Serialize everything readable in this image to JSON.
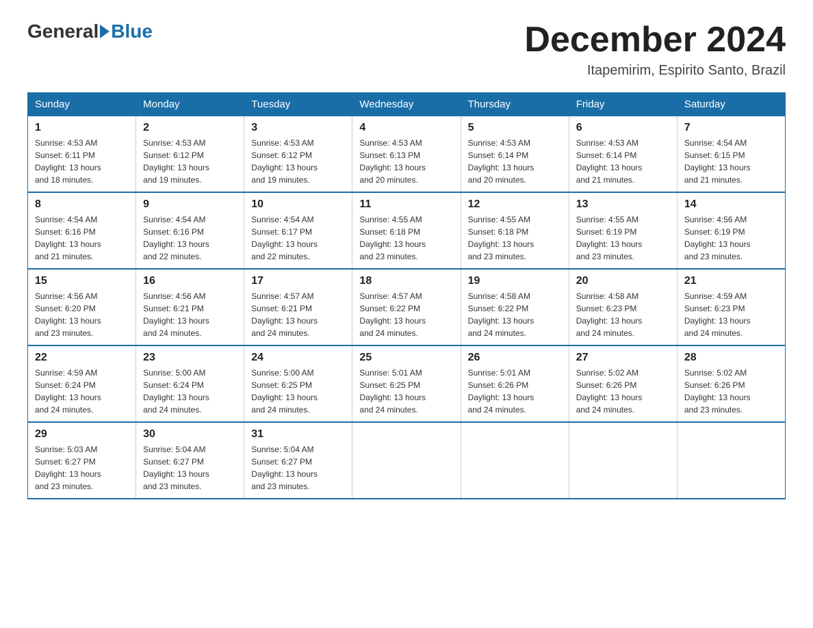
{
  "logo": {
    "general": "General",
    "blue": "Blue"
  },
  "title": "December 2024",
  "subtitle": "Itapemirim, Espirito Santo, Brazil",
  "days_of_week": [
    "Sunday",
    "Monday",
    "Tuesday",
    "Wednesday",
    "Thursday",
    "Friday",
    "Saturday"
  ],
  "weeks": [
    [
      {
        "day": "1",
        "sunrise": "4:53 AM",
        "sunset": "6:11 PM",
        "daylight": "13 hours and 18 minutes."
      },
      {
        "day": "2",
        "sunrise": "4:53 AM",
        "sunset": "6:12 PM",
        "daylight": "13 hours and 19 minutes."
      },
      {
        "day": "3",
        "sunrise": "4:53 AM",
        "sunset": "6:12 PM",
        "daylight": "13 hours and 19 minutes."
      },
      {
        "day": "4",
        "sunrise": "4:53 AM",
        "sunset": "6:13 PM",
        "daylight": "13 hours and 20 minutes."
      },
      {
        "day": "5",
        "sunrise": "4:53 AM",
        "sunset": "6:14 PM",
        "daylight": "13 hours and 20 minutes."
      },
      {
        "day": "6",
        "sunrise": "4:53 AM",
        "sunset": "6:14 PM",
        "daylight": "13 hours and 21 minutes."
      },
      {
        "day": "7",
        "sunrise": "4:54 AM",
        "sunset": "6:15 PM",
        "daylight": "13 hours and 21 minutes."
      }
    ],
    [
      {
        "day": "8",
        "sunrise": "4:54 AM",
        "sunset": "6:16 PM",
        "daylight": "13 hours and 21 minutes."
      },
      {
        "day": "9",
        "sunrise": "4:54 AM",
        "sunset": "6:16 PM",
        "daylight": "13 hours and 22 minutes."
      },
      {
        "day": "10",
        "sunrise": "4:54 AM",
        "sunset": "6:17 PM",
        "daylight": "13 hours and 22 minutes."
      },
      {
        "day": "11",
        "sunrise": "4:55 AM",
        "sunset": "6:18 PM",
        "daylight": "13 hours and 23 minutes."
      },
      {
        "day": "12",
        "sunrise": "4:55 AM",
        "sunset": "6:18 PM",
        "daylight": "13 hours and 23 minutes."
      },
      {
        "day": "13",
        "sunrise": "4:55 AM",
        "sunset": "6:19 PM",
        "daylight": "13 hours and 23 minutes."
      },
      {
        "day": "14",
        "sunrise": "4:56 AM",
        "sunset": "6:19 PM",
        "daylight": "13 hours and 23 minutes."
      }
    ],
    [
      {
        "day": "15",
        "sunrise": "4:56 AM",
        "sunset": "6:20 PM",
        "daylight": "13 hours and 23 minutes."
      },
      {
        "day": "16",
        "sunrise": "4:56 AM",
        "sunset": "6:21 PM",
        "daylight": "13 hours and 24 minutes."
      },
      {
        "day": "17",
        "sunrise": "4:57 AM",
        "sunset": "6:21 PM",
        "daylight": "13 hours and 24 minutes."
      },
      {
        "day": "18",
        "sunrise": "4:57 AM",
        "sunset": "6:22 PM",
        "daylight": "13 hours and 24 minutes."
      },
      {
        "day": "19",
        "sunrise": "4:58 AM",
        "sunset": "6:22 PM",
        "daylight": "13 hours and 24 minutes."
      },
      {
        "day": "20",
        "sunrise": "4:58 AM",
        "sunset": "6:23 PM",
        "daylight": "13 hours and 24 minutes."
      },
      {
        "day": "21",
        "sunrise": "4:59 AM",
        "sunset": "6:23 PM",
        "daylight": "13 hours and 24 minutes."
      }
    ],
    [
      {
        "day": "22",
        "sunrise": "4:59 AM",
        "sunset": "6:24 PM",
        "daylight": "13 hours and 24 minutes."
      },
      {
        "day": "23",
        "sunrise": "5:00 AM",
        "sunset": "6:24 PM",
        "daylight": "13 hours and 24 minutes."
      },
      {
        "day": "24",
        "sunrise": "5:00 AM",
        "sunset": "6:25 PM",
        "daylight": "13 hours and 24 minutes."
      },
      {
        "day": "25",
        "sunrise": "5:01 AM",
        "sunset": "6:25 PM",
        "daylight": "13 hours and 24 minutes."
      },
      {
        "day": "26",
        "sunrise": "5:01 AM",
        "sunset": "6:26 PM",
        "daylight": "13 hours and 24 minutes."
      },
      {
        "day": "27",
        "sunrise": "5:02 AM",
        "sunset": "6:26 PM",
        "daylight": "13 hours and 24 minutes."
      },
      {
        "day": "28",
        "sunrise": "5:02 AM",
        "sunset": "6:26 PM",
        "daylight": "13 hours and 23 minutes."
      }
    ],
    [
      {
        "day": "29",
        "sunrise": "5:03 AM",
        "sunset": "6:27 PM",
        "daylight": "13 hours and 23 minutes."
      },
      {
        "day": "30",
        "sunrise": "5:04 AM",
        "sunset": "6:27 PM",
        "daylight": "13 hours and 23 minutes."
      },
      {
        "day": "31",
        "sunrise": "5:04 AM",
        "sunset": "6:27 PM",
        "daylight": "13 hours and 23 minutes."
      },
      null,
      null,
      null,
      null
    ]
  ],
  "labels": {
    "sunrise_prefix": "Sunrise: ",
    "sunset_prefix": "Sunset: ",
    "daylight_prefix": "Daylight: "
  }
}
